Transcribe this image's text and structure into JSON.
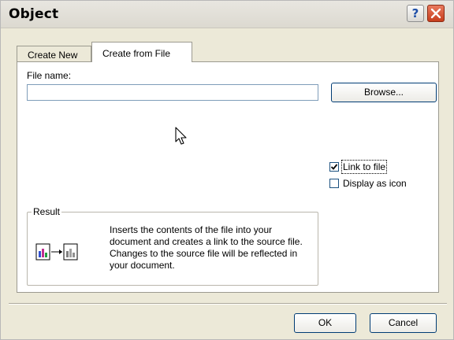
{
  "window": {
    "title": "Object",
    "help_glyph": "?",
    "help_icon": "help-icon",
    "close_icon": "close-icon"
  },
  "tabs": [
    {
      "label": "Create New",
      "active": false
    },
    {
      "label": "Create from File",
      "active": true
    }
  ],
  "file": {
    "label": "File name:",
    "value": "",
    "browse_label": "Browse..."
  },
  "options": {
    "link_to_file": {
      "label": "Link to file",
      "checked": true
    },
    "display_as_icon": {
      "label": "Display as icon",
      "checked": false
    }
  },
  "result": {
    "legend": "Result",
    "text": "Inserts the contents of the file into your document and creates a link to the source file. Changes to the source file will be reflected in your document."
  },
  "buttons": {
    "ok": "OK",
    "cancel": "Cancel"
  },
  "colors": {
    "dialog_bg": "#ece9d8",
    "panel_bg": "#ffffff",
    "button_border": "#003c74",
    "close_red": "#c73d1c"
  }
}
